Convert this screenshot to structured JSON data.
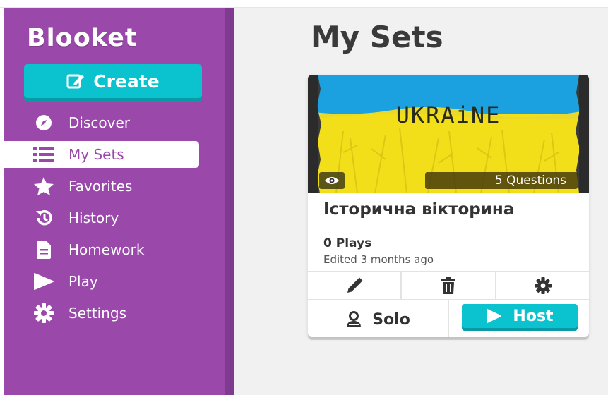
{
  "sidebar": {
    "logo": "Blooket",
    "create_label": "Create",
    "items": [
      {
        "label": "Discover",
        "icon": "compass-icon"
      },
      {
        "label": "My Sets",
        "icon": "list-icon",
        "active": true
      },
      {
        "label": "Favorites",
        "icon": "star-icon"
      },
      {
        "label": "History",
        "icon": "history-icon"
      },
      {
        "label": "Homework",
        "icon": "document-icon"
      },
      {
        "label": "Play",
        "icon": "play-icon"
      },
      {
        "label": "Settings",
        "icon": "gear-icon"
      }
    ]
  },
  "main": {
    "title": "My Sets",
    "set": {
      "image_text": "UKRAiNE",
      "questions": "5 Questions",
      "title": "Історична вікторина",
      "plays": "0 Plays",
      "edited": "Edited 3 months ago",
      "solo_label": "Solo",
      "host_label": "Host"
    }
  },
  "colors": {
    "sidebar": "#9a49aa",
    "accent": "#0bc2cf",
    "flag_blue": "#1ba0e0",
    "flag_yellow": "#f2df1a"
  }
}
